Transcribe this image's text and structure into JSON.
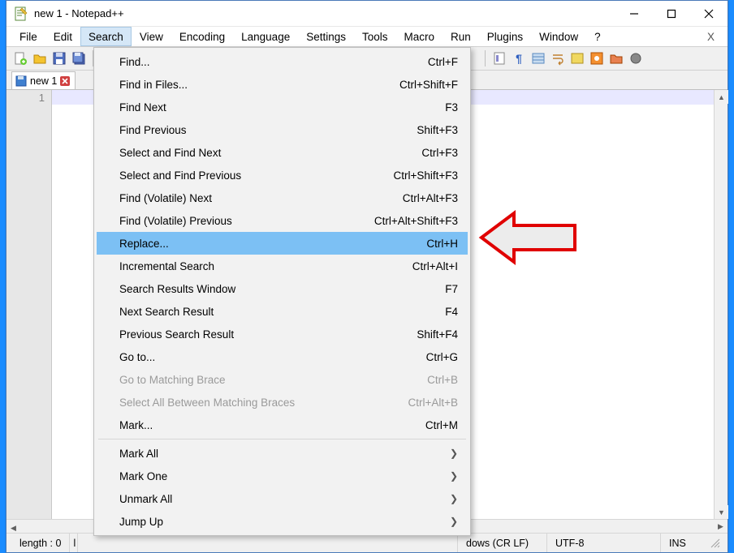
{
  "window": {
    "title": "new 1 - Notepad++"
  },
  "menubar": {
    "items": [
      "File",
      "Edit",
      "Search",
      "View",
      "Encoding",
      "Language",
      "Settings",
      "Tools",
      "Macro",
      "Run",
      "Plugins",
      "Window",
      "?"
    ],
    "x_label": "X",
    "open_index": 2
  },
  "tab": {
    "label": "new 1"
  },
  "gutter": {
    "lines": [
      "1"
    ]
  },
  "menu": {
    "groups": [
      [
        {
          "label": "Find...",
          "shortcut": "Ctrl+F",
          "disabled": false
        },
        {
          "label": "Find in Files...",
          "shortcut": "Ctrl+Shift+F",
          "disabled": false
        },
        {
          "label": "Find Next",
          "shortcut": "F3",
          "disabled": false
        },
        {
          "label": "Find Previous",
          "shortcut": "Shift+F3",
          "disabled": false
        },
        {
          "label": "Select and Find Next",
          "shortcut": "Ctrl+F3",
          "disabled": false
        },
        {
          "label": "Select and Find Previous",
          "shortcut": "Ctrl+Shift+F3",
          "disabled": false
        },
        {
          "label": "Find (Volatile) Next",
          "shortcut": "Ctrl+Alt+F3",
          "disabled": false
        },
        {
          "label": "Find (Volatile) Previous",
          "shortcut": "Ctrl+Alt+Shift+F3",
          "disabled": false
        },
        {
          "label": "Replace...",
          "shortcut": "Ctrl+H",
          "disabled": false,
          "highlight": true
        },
        {
          "label": "Incremental Search",
          "shortcut": "Ctrl+Alt+I",
          "disabled": false
        },
        {
          "label": "Search Results Window",
          "shortcut": "F7",
          "disabled": false
        },
        {
          "label": "Next Search Result",
          "shortcut": "F4",
          "disabled": false
        },
        {
          "label": "Previous Search Result",
          "shortcut": "Shift+F4",
          "disabled": false
        },
        {
          "label": "Go to...",
          "shortcut": "Ctrl+G",
          "disabled": false
        },
        {
          "label": "Go to Matching Brace",
          "shortcut": "Ctrl+B",
          "disabled": true
        },
        {
          "label": "Select All Between Matching Braces",
          "shortcut": "Ctrl+Alt+B",
          "disabled": true
        },
        {
          "label": "Mark...",
          "shortcut": "Ctrl+M",
          "disabled": false
        }
      ],
      [
        {
          "label": "Mark All",
          "submenu": true,
          "disabled": false
        },
        {
          "label": "Mark One",
          "submenu": true,
          "disabled": false
        },
        {
          "label": "Unmark All",
          "submenu": true,
          "disabled": false
        },
        {
          "label": "Jump Up",
          "submenu": true,
          "disabled": false
        }
      ]
    ]
  },
  "status": {
    "length": "length : 0",
    "lncol_partial": "l",
    "eol": "dows (CR LF)",
    "encoding": "UTF-8",
    "mode": "INS"
  }
}
